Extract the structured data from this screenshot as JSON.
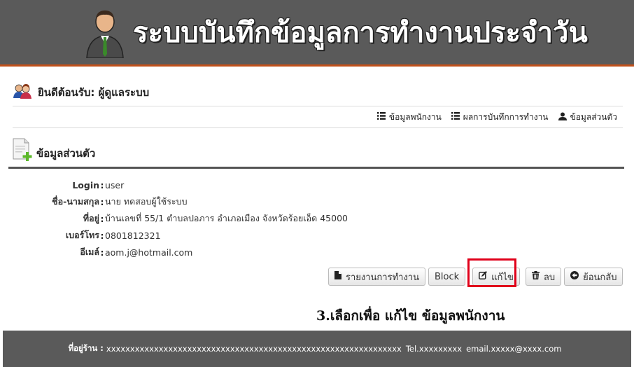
{
  "header": {
    "title": "ระบบบันทึกข้อมูลการทำงานประจำวัน",
    "avatar_icon": "businessman-icon"
  },
  "welcome": {
    "text": "ยินดีต้อนรับ: ผู้ดูแลระบบ",
    "icon": "users-icon"
  },
  "nav": {
    "items": [
      {
        "label": "ข้อมูลพนักงาน",
        "icon": "list-icon"
      },
      {
        "label": "ผลการบันทึกการทำงาน",
        "icon": "list-icon"
      },
      {
        "label": "ข้อมูลส่วนตัว",
        "icon": "user-icon"
      }
    ]
  },
  "section": {
    "title": "ข้อมูลส่วนตัว",
    "icon": "document-add-icon"
  },
  "profile": {
    "rows": [
      {
        "label": "Login",
        "value": "user"
      },
      {
        "label": "ชื่อ-นามสกุล",
        "value": "นาย ทดสอบผู้ใช้ระบบ"
      },
      {
        "label": "ที่อยู่",
        "value": "บ้านเลขที่ 55/1 ตำบลปอภาร อำเภอเมือง จังหวัดร้อยเอ็ด 45000"
      },
      {
        "label": "เบอร์โทร",
        "value": "0801812321"
      },
      {
        "label": "อีเมล์",
        "value": "aom.j@hotmail.com"
      }
    ]
  },
  "buttons": {
    "report": "รายงานการทำงาน",
    "block": "Block",
    "edit": "แก้ไข",
    "delete": "ลบ",
    "back": "ย้อนกลับ"
  },
  "instruction": "3.เลือกเพื่อ แก้ไข ข้อมูลพนักงาน",
  "footer": {
    "address_label": "ที่อยู่ร้าน :",
    "address_value": "xxxxxxxxxxxxxxxxxxxxxxxxxxxxxxxxxxxxxxxxxxxxxxxxxxxxxxxxxxxxxx",
    "tel": "Tel.xxxxxxxxx",
    "email": "email.xxxxx@xxxx.com"
  },
  "colors": {
    "banner": "#5a5a5a",
    "accent": "#c0501a",
    "highlight": "#e0001a"
  }
}
